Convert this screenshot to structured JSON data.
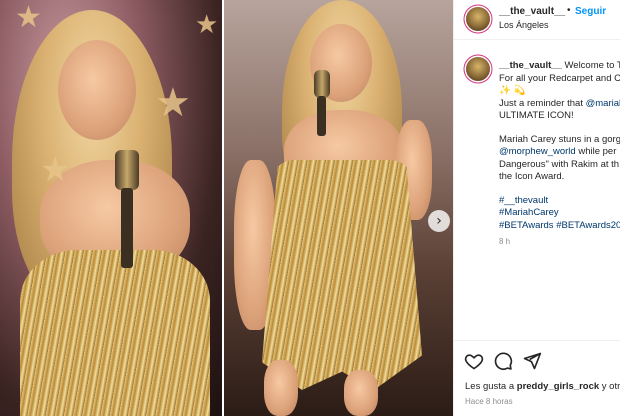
{
  "post": {
    "username": "__the_vault__",
    "follow_label": "Seguir",
    "separator": "•",
    "location": "Los Ángeles",
    "caption_lines": [
      "Welcome to T",
      "For all your Redcarpet and C",
      "✨ 💫",
      "Just a reminder that",
      "@mariah",
      "ULTIMATE ICON!",
      "Mariah Carey stuns in a gorg",
      "@morphew_world",
      "while per",
      "Dangerous\" with Rakim at th",
      "the Icon Award.",
      "#__thevault",
      "#MariahCarey",
      "#BETAwards",
      "#BETAwards202"
    ],
    "caption_time": "8 h",
    "likes_prefix": "Les gusta a",
    "likes_user": "preddy_girls_rock",
    "likes_suffix": "y otra",
    "posted_ago": "Hace 8 horas"
  },
  "icons": {
    "like": "heart-icon",
    "comment": "comment-icon",
    "share": "share-icon",
    "next": "chevron-right-icon"
  },
  "colors": {
    "follow": "#0095f6",
    "link": "#00376b",
    "muted": "#8e8e8e",
    "avatar_ring": "#d42f7b"
  }
}
